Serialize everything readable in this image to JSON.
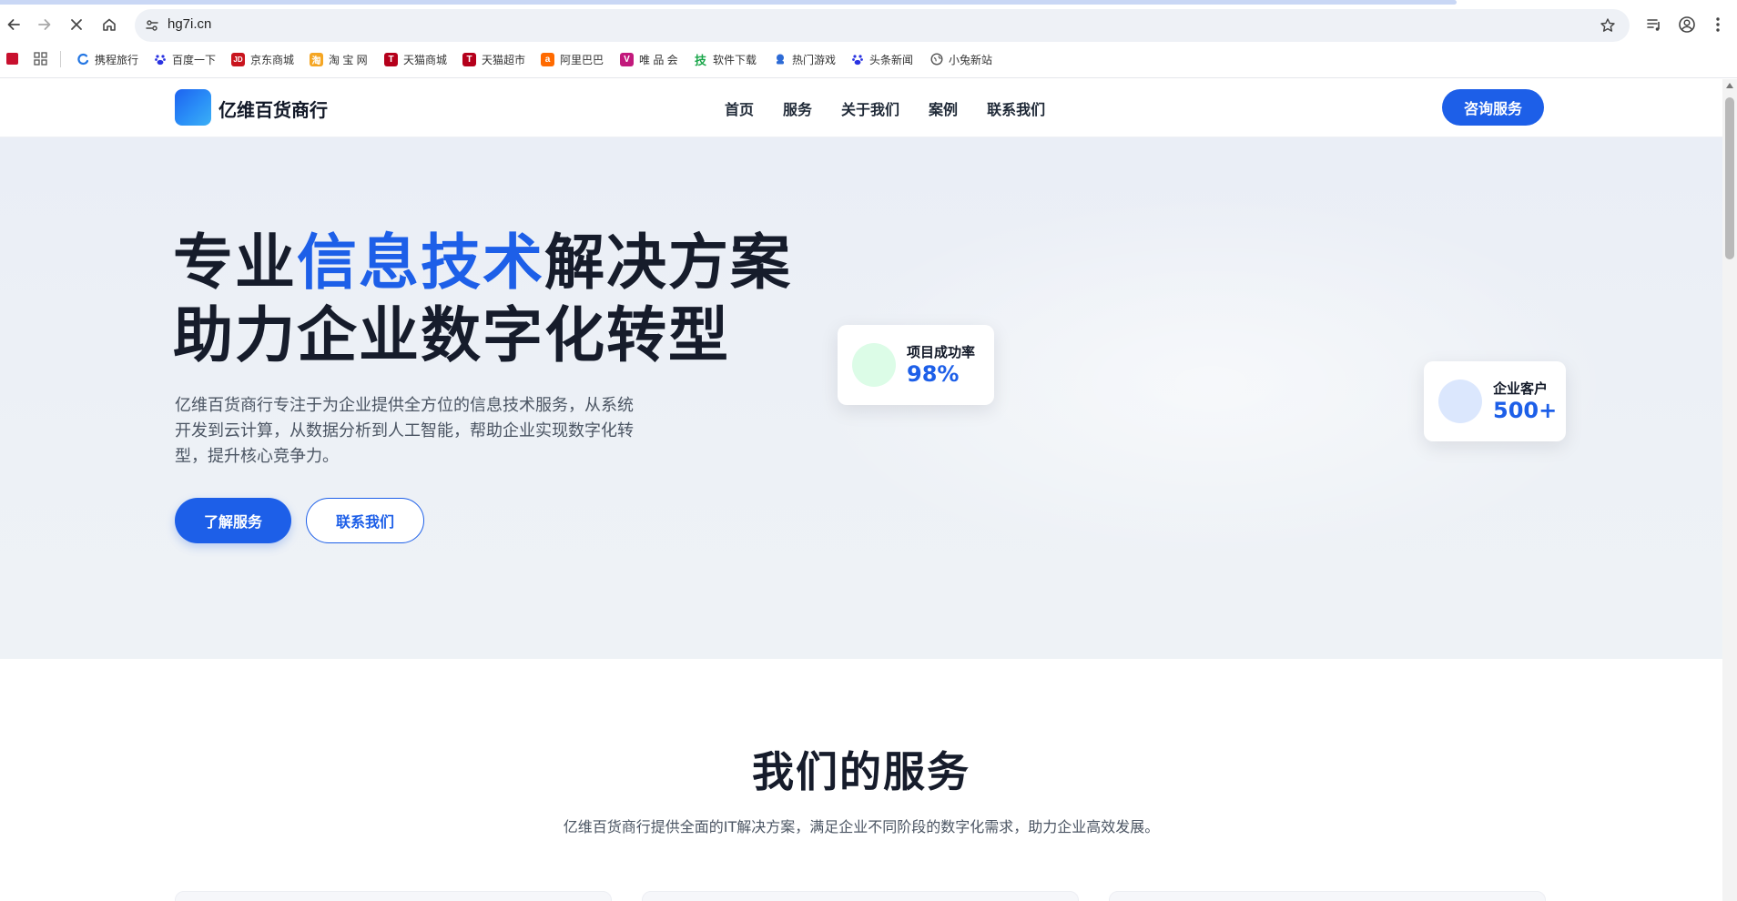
{
  "browser": {
    "url": "hg7i.cn",
    "bookmarks": [
      {
        "label": "携程旅行",
        "icon": "ctrip-icon",
        "color": "#2577e3"
      },
      {
        "label": "百度一下",
        "icon": "baidu-icon",
        "color": "#2932e1"
      },
      {
        "label": "京东商城",
        "icon": "jd-icon",
        "color": "#c9151e",
        "glyph": "JD"
      },
      {
        "label": "淘 宝 网",
        "icon": "taobao-icon",
        "color": "#f5a623",
        "glyph": "淘"
      },
      {
        "label": "天猫商城",
        "icon": "tmall-icon",
        "color": "#b5001b",
        "glyph": "T"
      },
      {
        "label": "天猫超市",
        "icon": "tmall-market-icon",
        "color": "#b5001b",
        "glyph": "T"
      },
      {
        "label": "阿里巴巴",
        "icon": "alibaba-icon",
        "color": "#ff6a00",
        "glyph": "a"
      },
      {
        "label": "唯 品 会",
        "icon": "vip-icon",
        "color": "#c2197c",
        "glyph": "V"
      },
      {
        "label": "软件下载",
        "icon": "software-download-icon",
        "color": "#1aa64a",
        "glyph": "技"
      },
      {
        "label": "热门游戏",
        "icon": "games-icon",
        "color": "#2d6bd6"
      },
      {
        "label": "头条新闻",
        "icon": "news-icon",
        "color": "#2932e1"
      },
      {
        "label": "小兔新站",
        "icon": "globe-icon",
        "color": "#555555"
      }
    ]
  },
  "header": {
    "logo_text": "亿维百货商行",
    "nav": [
      "首页",
      "服务",
      "关于我们",
      "案例",
      "联系我们"
    ],
    "cta": "咨询服务"
  },
  "hero": {
    "title_prefix": "专业",
    "title_accent": "信息技术",
    "title_suffix": "解决方案",
    "title_line2": "助力企业数字化转型",
    "description": "亿维百货商行专注于为企业提供全方位的信息技术服务，从系统开发到云计算，从数据分析到人工智能，帮助企业实现数字化转型，提升核心竞争力。",
    "primary_button": "了解服务",
    "secondary_button": "联系我们",
    "stats": [
      {
        "label": "项目成功率",
        "value": "98%",
        "dot_color": "#dcfce7"
      },
      {
        "label": "企业客户",
        "value": "500+",
        "dot_color": "#dbe7fd"
      }
    ]
  },
  "services": {
    "title": "我们的服务",
    "subtitle": "亿维百货商行提供全面的IT解决方案，满足企业不同阶段的数字化需求，助力企业高效发展。"
  },
  "colors": {
    "accent": "#1d5fe8",
    "heading": "#161c2b",
    "hero_bg": "#edf1f6"
  }
}
